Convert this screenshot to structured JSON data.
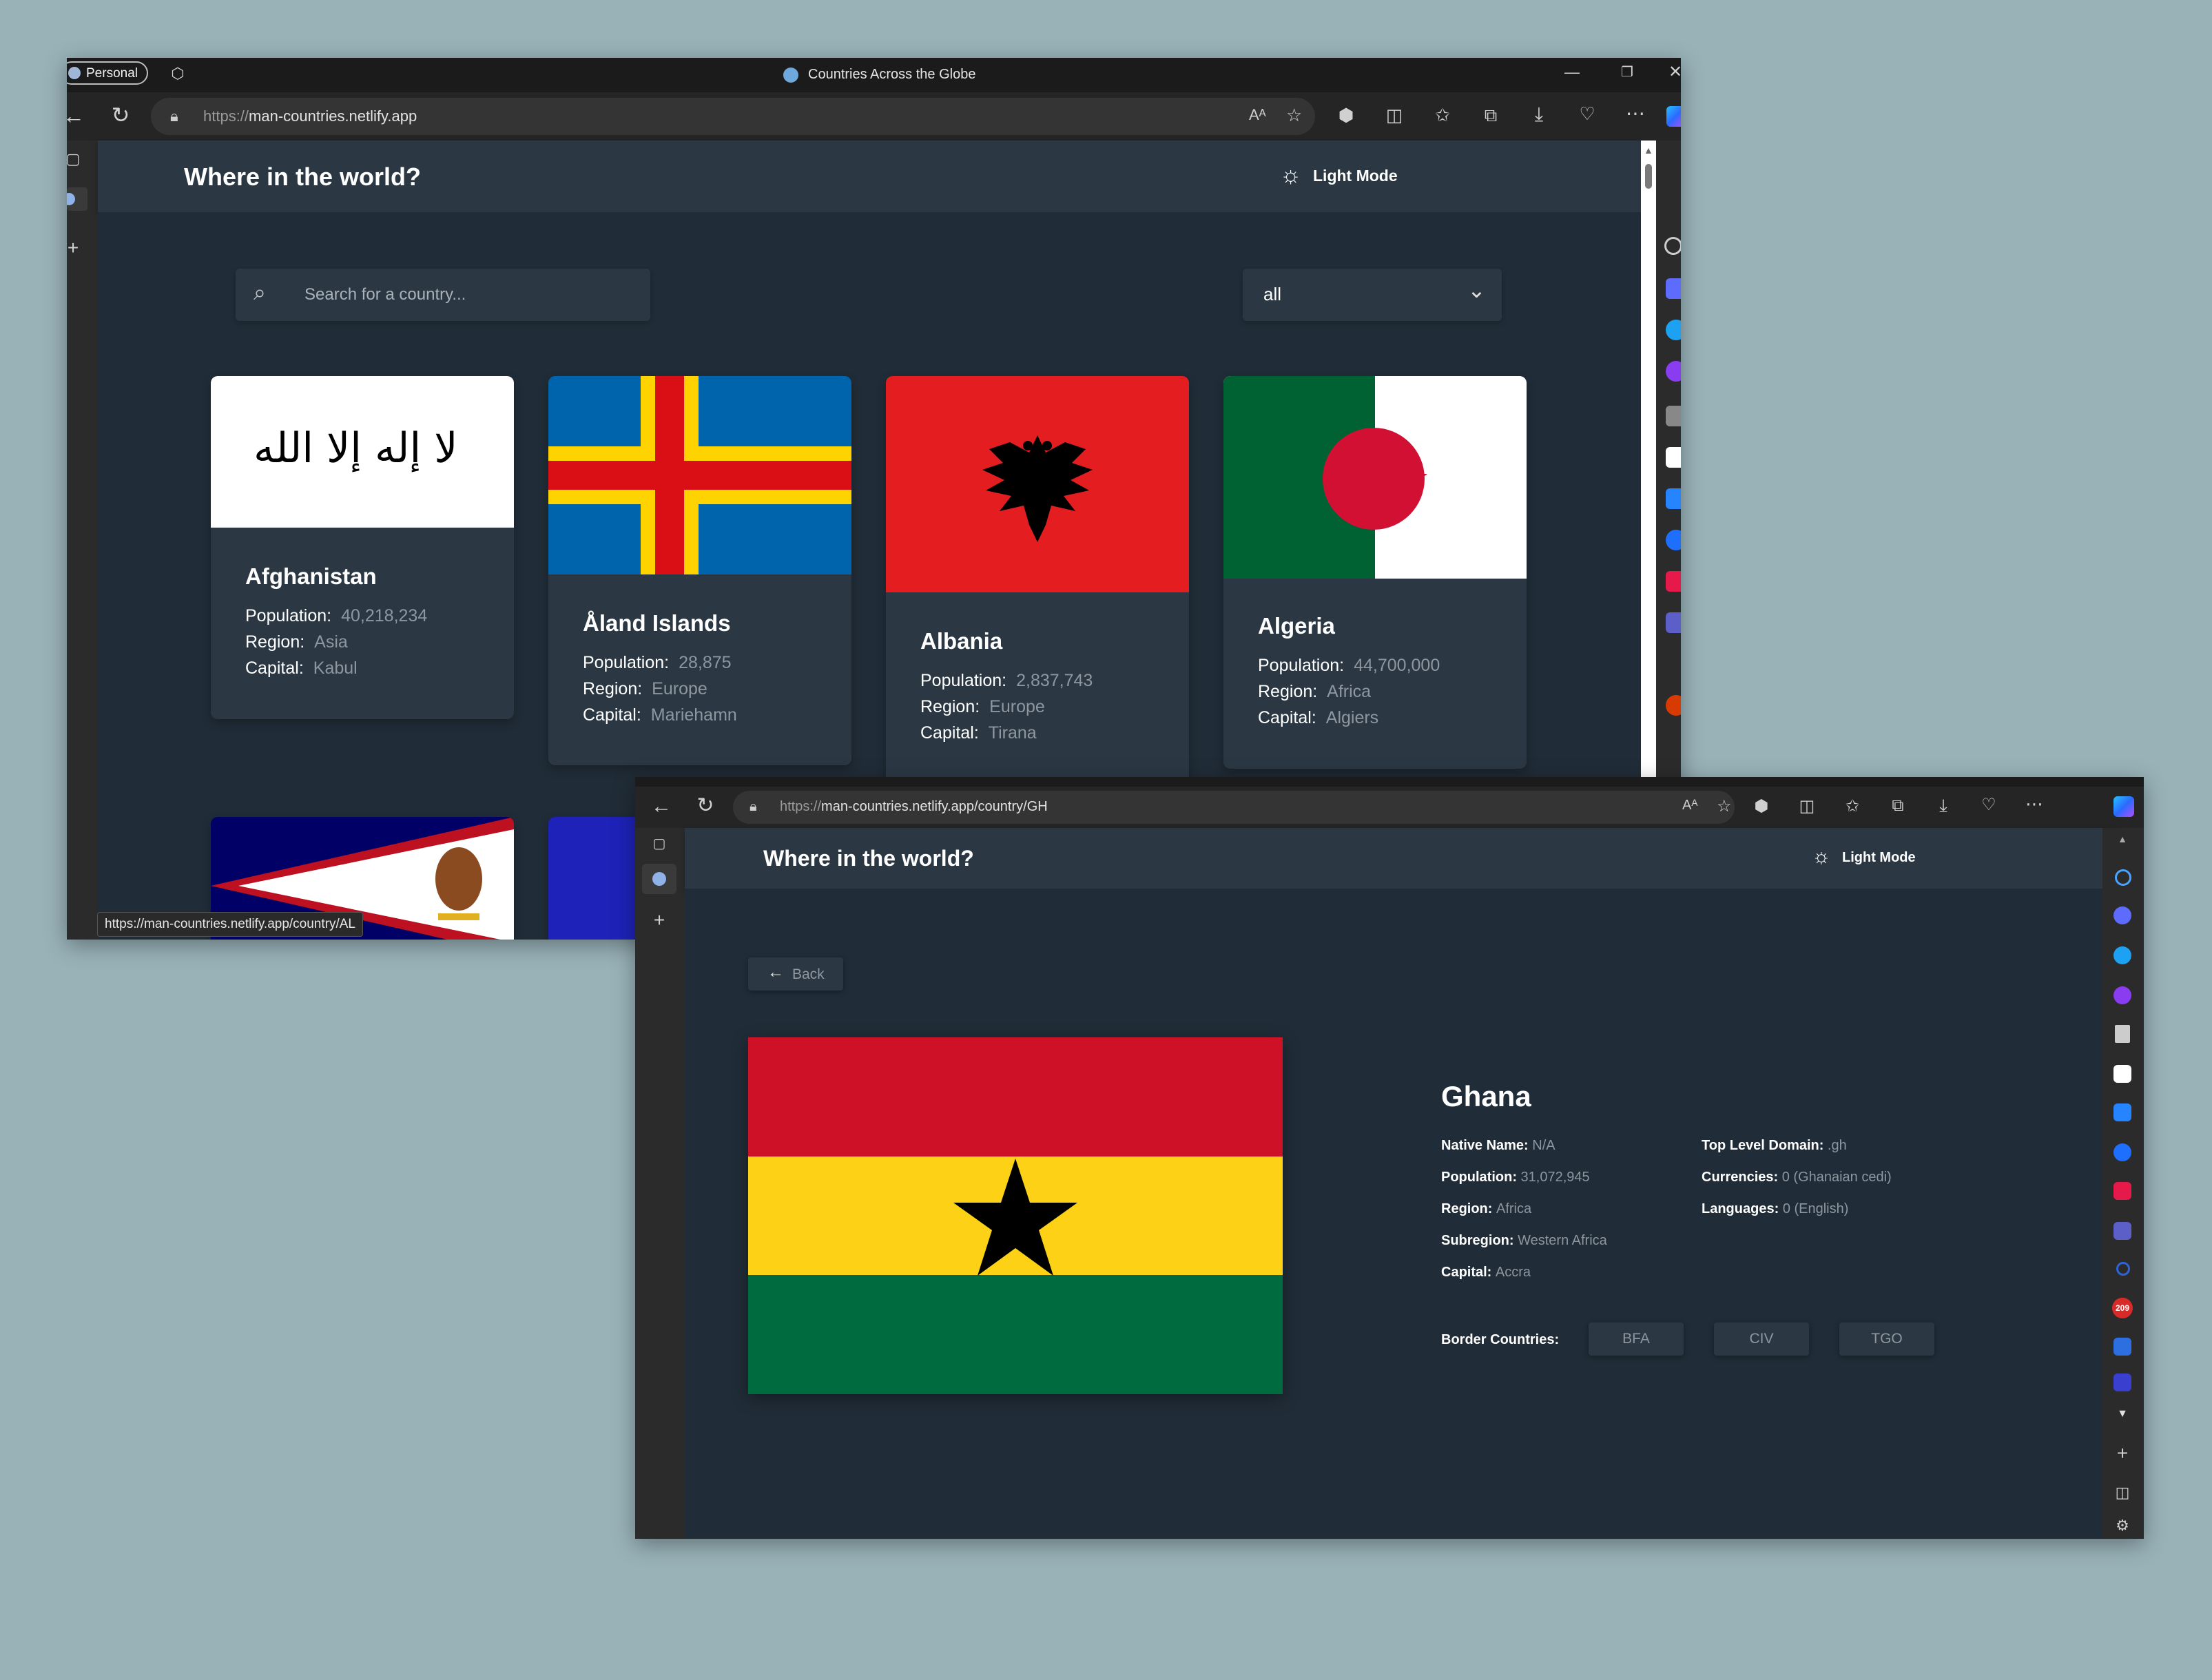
{
  "window1": {
    "profile_label": "Personal",
    "tab_title": "Countries Across the Globe",
    "url_proto": "https://",
    "url_host": "man-countries.netlify.app",
    "status_url": "https://man-countries.netlify.app/country/AL"
  },
  "app": {
    "title": "Where in the world?",
    "mode_label": "Light Mode"
  },
  "list": {
    "search_placeholder": "Search for a country...",
    "filter_value": "all",
    "labels": {
      "population": "Population:",
      "region": "Region:",
      "capital": "Capital:"
    },
    "cards": [
      {
        "name": "Afghanistan",
        "population": "40,218,234",
        "region": "Asia",
        "capital": "Kabul"
      },
      {
        "name": "Åland Islands",
        "population": "28,875",
        "region": "Europe",
        "capital": "Mariehamn"
      },
      {
        "name": "Albania",
        "population": "2,837,743",
        "region": "Europe",
        "capital": "Tirana"
      },
      {
        "name": "Algeria",
        "population": "44,700,000",
        "region": "Africa",
        "capital": "Algiers"
      }
    ]
  },
  "window2": {
    "url_proto": "https://",
    "url_host": "man-countries.netlify.app/country/GH",
    "badge_count": "209"
  },
  "detail": {
    "back_label": "Back",
    "name": "Ghana",
    "native_name_label": "Native Name:",
    "native_name": "N/A",
    "population_label": "Population:",
    "population": "31,072,945",
    "region_label": "Region:",
    "region": "Africa",
    "subregion_label": "Subregion:",
    "subregion": "Western Africa",
    "capital_label": "Capital:",
    "capital": "Accra",
    "tld_label": "Top Level Domain:",
    "tld": ".gh",
    "currencies_label": "Currencies:",
    "currencies": "0 (Ghanaian cedi)",
    "languages_label": "Languages:",
    "languages": "0 (English)",
    "borders_label": "Border Countries:",
    "borders": [
      "BFA",
      "CIV",
      "TGO"
    ]
  },
  "colors": {
    "desktop": "#98b2b8",
    "app_bg": "#202c37",
    "app_elements": "#2b3844",
    "muted_text": "#8e979f",
    "ghana_red": "#ce1126",
    "ghana_yellow": "#fcd116",
    "ghana_green": "#006b3f"
  }
}
